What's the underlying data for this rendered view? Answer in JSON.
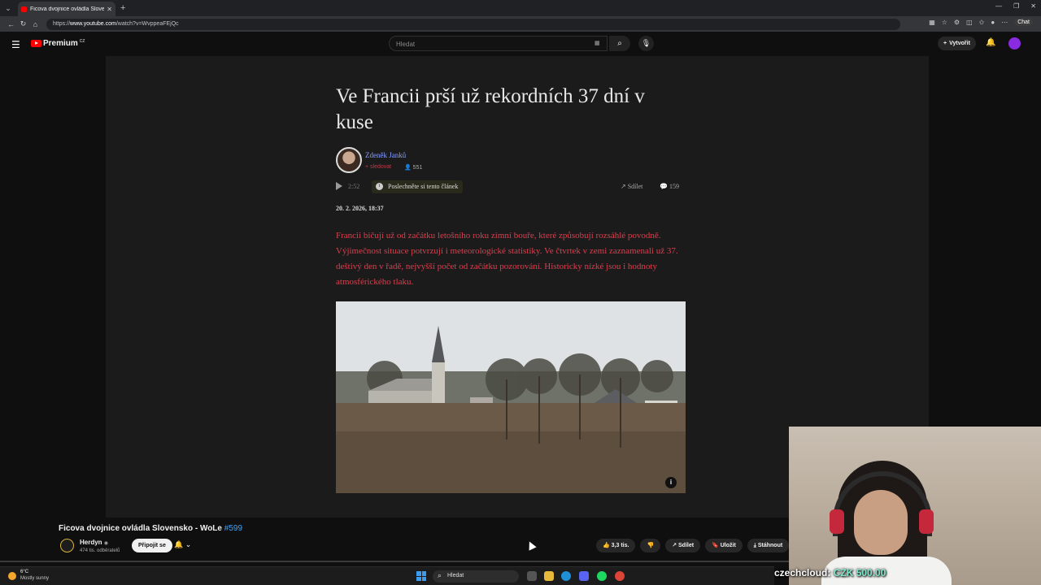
{
  "browser": {
    "tab_title": "Ficova dvojnice ovládla Slovensko",
    "url_prefix": "https://",
    "url_domain": "www.youtube.com",
    "url_path": "/watch?v=WvppeaFEjQc",
    "chat_label": "Chat"
  },
  "youtube": {
    "logo_text": "Premium",
    "logo_region": "CZ",
    "search_placeholder": "Hledat",
    "create_label": "Vytvořit"
  },
  "article": {
    "title": "Ve Francii prší už rekordních 37 dní v kuse",
    "author": "Zdeněk Janků",
    "follow_label": "+ sledovat",
    "followers": "551",
    "audio_time": "2:52",
    "listen_label": "Poslechněte si tento článek",
    "share_label": "Sdílet",
    "comment_count": "159",
    "date": "20. 2. 2026, 18:37",
    "lead": "Francii bičují už od začátku letošního roku zimní bouře, které způsobují rozsáhlé povodně. Výjimečnost situace potvrzují i meteorologické statistiky. Ve čtvrtek v zemi zaznamenali už 37. deštivý den v řadě, nejvyšší počet od začátku pozorování. Historicky nízké jsou i hodnoty atmosférického tlaku."
  },
  "video": {
    "title": "Ficova dvojnice ovládla Slovensko - WoLe",
    "tag": "#599",
    "channel": "Herdyn",
    "subscribers": "474 tis. odběratelů",
    "join_label": "Připojit se",
    "likes": "3,3 tis.",
    "share_label": "Sdílet",
    "save_label": "Uložit",
    "download_label": "Stáhnout"
  },
  "stream": {
    "donation_user": "czechcloud:",
    "donation_amount": "CZK 500.00"
  },
  "taskbar": {
    "temperature": "6°C",
    "condition": "Mostly sunny",
    "search_label": "Hledat"
  },
  "colors": {
    "accent_red": "#ff0000",
    "lead_red": "#d9404f",
    "link_blue": "#3ea6ff"
  }
}
